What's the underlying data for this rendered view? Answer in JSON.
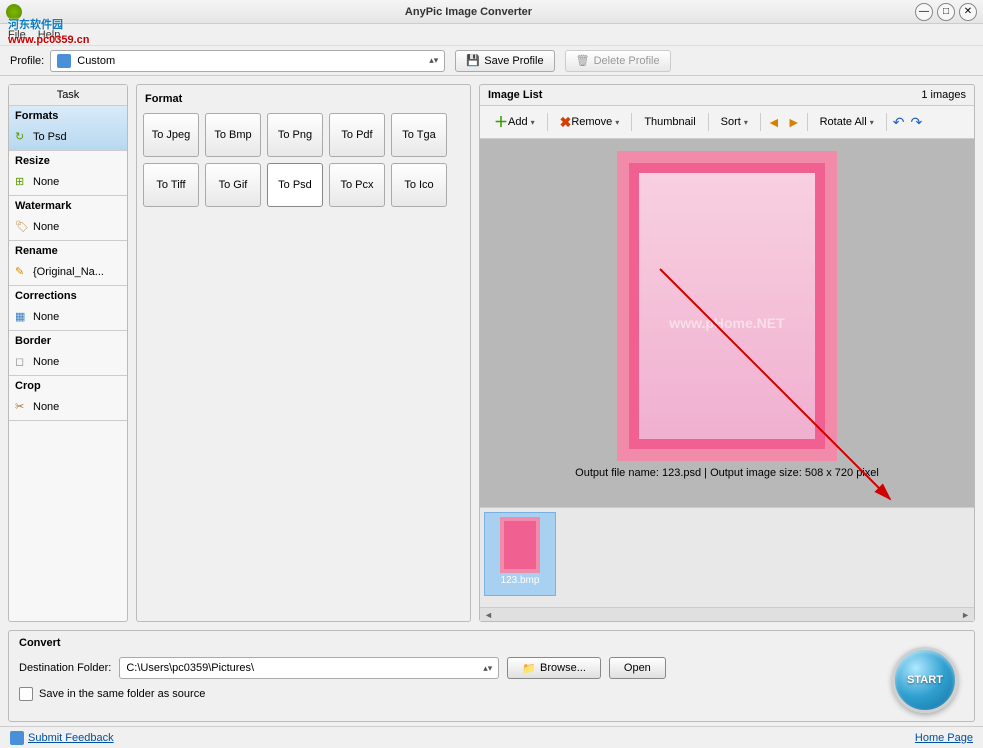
{
  "app": {
    "title": "AnyPic Image Converter"
  },
  "menu": {
    "file": "File",
    "help": "Help"
  },
  "watermark_logo": {
    "main": "河东软件园",
    "sub": "www.pc0359.cn"
  },
  "profile": {
    "label": "Profile:",
    "selected": "Custom",
    "save": "Save Profile",
    "delete": "Delete Profile"
  },
  "task": {
    "header": "Task",
    "sections": [
      {
        "title": "Formats",
        "value": "To Psd",
        "icon": "↻",
        "cls": "ico-refresh",
        "active": true
      },
      {
        "title": "Resize",
        "value": "None",
        "icon": "⊞",
        "cls": "ico-resize"
      },
      {
        "title": "Watermark",
        "value": "None",
        "icon": "🏷",
        "cls": "ico-tag"
      },
      {
        "title": "Rename",
        "value": "{Original_Na...",
        "icon": "✎",
        "cls": "ico-pencil"
      },
      {
        "title": "Corrections",
        "value": "None",
        "icon": "▦",
        "cls": "ico-correct"
      },
      {
        "title": "Border",
        "value": "None",
        "icon": "◻",
        "cls": "ico-border"
      },
      {
        "title": "Crop",
        "value": "None",
        "icon": "✂",
        "cls": "ico-crop"
      }
    ]
  },
  "format": {
    "title": "Format",
    "buttons": [
      "To Jpeg",
      "To Bmp",
      "To Png",
      "To Pdf",
      "To Tga",
      "To Tiff",
      "To Gif",
      "To Psd",
      "To Pcx",
      "To Ico"
    ],
    "selected_index": 7
  },
  "imagelist": {
    "title": "Image List",
    "count": "1 images",
    "toolbar": {
      "add": "Add",
      "remove": "Remove",
      "thumbnail": "Thumbnail",
      "sort": "Sort",
      "rotate_all": "Rotate All"
    },
    "preview_caption": "Output file name: 123.psd | Output image size: 508 x 720 pixel",
    "center_watermark": "www.pHome.NET",
    "thumbs": [
      {
        "label": "123.bmp"
      }
    ]
  },
  "convert": {
    "title": "Convert",
    "dest_label": "Destination Folder:",
    "dest_path": "C:\\Users\\pc0359\\Pictures\\",
    "browse": "Browse...",
    "open": "Open",
    "same_folder": "Save in the same folder as source",
    "start": "START"
  },
  "status": {
    "feedback": "Submit Feedback",
    "home": "Home Page"
  }
}
